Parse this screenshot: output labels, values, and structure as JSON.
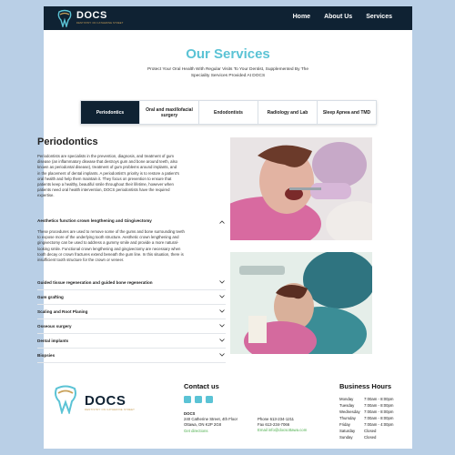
{
  "header": {
    "logo_text": "DOCS",
    "logo_sub": "DENTISTRY ON CATHERINE STREET",
    "nav": [
      "Home",
      "About Us",
      "Services"
    ]
  },
  "hero": {
    "title": "Our Services",
    "subtitle": "Protect Your Oral Health With Regular Visits To Your Dentist, Supplemented By The Speciality Services Provided At DOCS"
  },
  "tabs": [
    {
      "label": "Periodontics",
      "active": true
    },
    {
      "label": "Oral and maxillofacial surgery",
      "active": false
    },
    {
      "label": "Endodontists",
      "active": false
    },
    {
      "label": "Radiology and Lab",
      "active": false
    },
    {
      "label": "Sleep Apnea and TMD",
      "active": false
    }
  ],
  "section": {
    "title": "Periodontics",
    "body": "Periodontists are specialists in the prevention, diagnosis, and treatment of gum disease (an inflammatory disease that destroys gum and bone around teeth, also known as periodontal disease), treatment of gum problems around implants, and in the placement of dental implants. A periodontist's priority is to restore a patient's oral health and help them maintain it. They focus on prevention to ensure that patients keep a healthy, beautiful smile throughout their lifetime, however when patients need oral health intervention, DOCS periodontists have the required expertise."
  },
  "accordion": {
    "open": {
      "title": "Aesthetics function crown lengthening and Gingivectomy",
      "body": "These procedures are used to remove some of the gums and bone surrounding teeth to expose more of the underlying tooth structure. Aesthetic crown lengthening and gingivectomy can be used to address a gummy smile and provide a more natural-looking smile. Functional crown lengthening and gingivectomy are necessary when tooth decay or crown fractures extend beneath the gum line. In this situation, there is insufficient tooth structure for the crown or veneer."
    },
    "items": [
      "Guided tissue regeneration and guided bone regeneration",
      "Gum grafting",
      "Scaling and Root Planing",
      "Osseous surgery",
      "Dental implants",
      "Biopsies"
    ]
  },
  "footer": {
    "logo_text": "DOCS",
    "logo_sub": "DENTISTRY ON CATHERINE STREET",
    "contact_title": "Contact us",
    "address_name": "DOCS",
    "address_line1": "240 Catherine Street, 4th Floor",
    "address_line2": "Ottawa, ON K2P 2G8",
    "directions": "Get directions",
    "phone": "Phone 613-234-1211",
    "fax": "Fax 613-234-7066",
    "email": "Email info@docsottawa.com",
    "hours_title": "Business Hours",
    "hours": [
      {
        "day": "Monday",
        "time": "7:00am - 8:00pm"
      },
      {
        "day": "Tuesday",
        "time": "7:00am - 8:00pm"
      },
      {
        "day": "Wednesday",
        "time": "7:00am - 8:00pm"
      },
      {
        "day": "Thursday",
        "time": "7:00am - 8:00pm"
      },
      {
        "day": "Friday",
        "time": "7:00am - 4:00pm"
      },
      {
        "day": "Saturday",
        "time": "Closed"
      },
      {
        "day": "Sunday",
        "time": "Closed"
      }
    ]
  },
  "colors": {
    "navy": "#0f2233",
    "teal": "#5bc3d5",
    "link_green": "#4cae4c",
    "page_bg": "#b9cfe6"
  }
}
